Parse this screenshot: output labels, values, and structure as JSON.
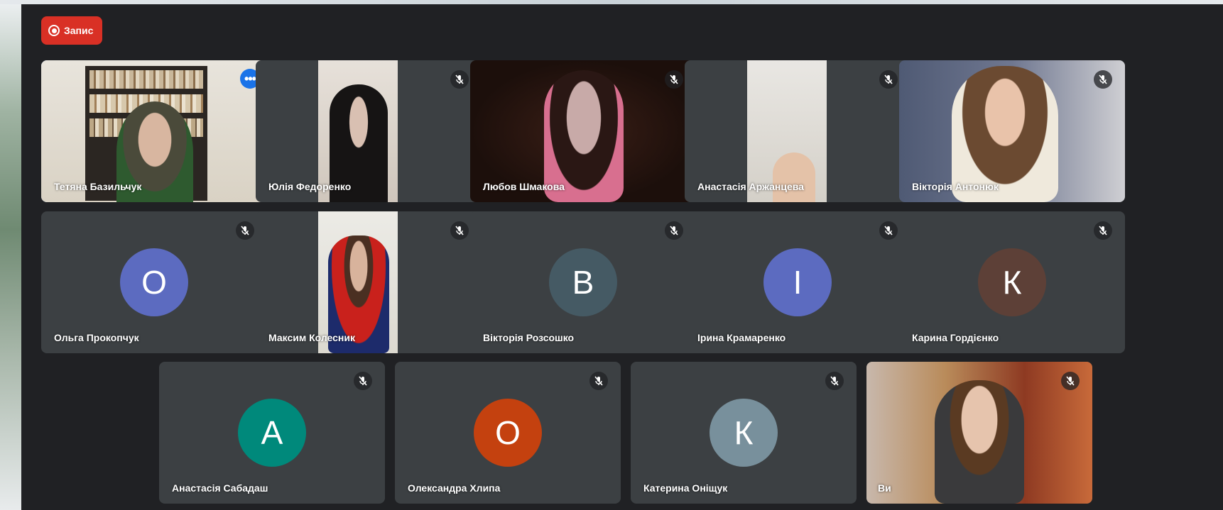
{
  "recording": {
    "label": "Запис"
  },
  "colors": {
    "record": "#d93025",
    "tile": "#3c4043",
    "window": "#202124",
    "active_outline": "#8ab4f8"
  },
  "participants": [
    {
      "name": "Тетяна Базильчук",
      "video": true,
      "active": true,
      "icon": "more-options-icon"
    },
    {
      "name": "Юлія Федоренко",
      "video": true,
      "muted": true
    },
    {
      "name": "Любов Шмакова",
      "video": true,
      "muted": true
    },
    {
      "name": "Анастасія Аржанцева",
      "video": true,
      "muted": true
    },
    {
      "name": "Вікторія Антонюк",
      "video": true,
      "muted": true
    },
    {
      "name": "Ольга Прокопчук",
      "initial": "О",
      "avatar_color": "#5c6bc0",
      "muted": true
    },
    {
      "name": "Максим Колесник",
      "video": true,
      "muted": true
    },
    {
      "name": "Вікторія Розсошко",
      "initial": "В",
      "avatar_color": "#455a64",
      "muted": true
    },
    {
      "name": "Ірина Крамаренко",
      "initial": "І",
      "avatar_color": "#5c6bc0",
      "muted": true
    },
    {
      "name": "Карина Гордієнко",
      "initial": "К",
      "avatar_color": "#5d4037",
      "muted": true
    },
    {
      "name": "Анастасія Сабадаш",
      "initial": "А",
      "avatar_color": "#00897b",
      "muted": true
    },
    {
      "name": "Олександра Хлипа",
      "initial": "О",
      "avatar_color": "#c4410f",
      "muted": true
    },
    {
      "name": "Катерина Оніщук",
      "initial": "К",
      "avatar_color": "#78909c",
      "muted": true
    },
    {
      "name": "Ви",
      "video": true,
      "muted": true
    }
  ]
}
